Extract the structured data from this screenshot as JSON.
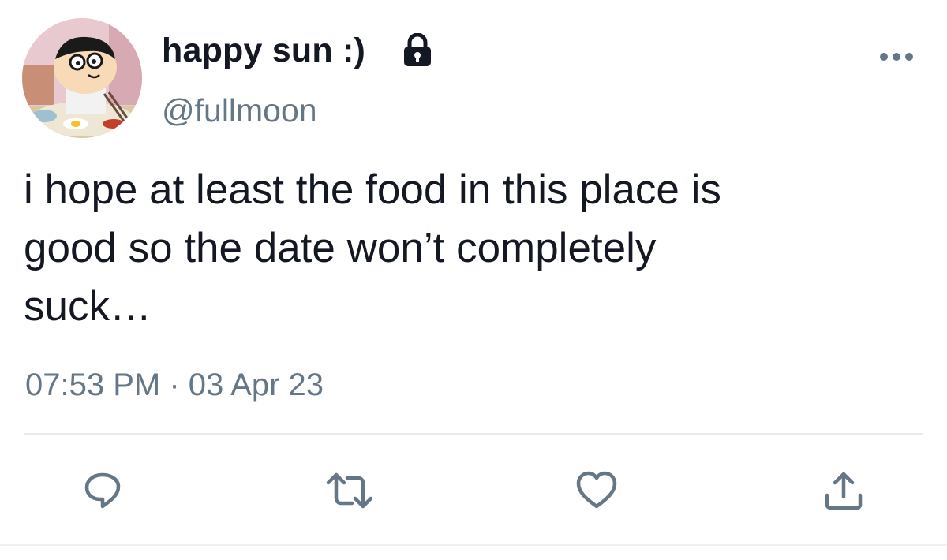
{
  "user": {
    "display_name": "happy sun :)",
    "handle": "@fullmoon",
    "protected_icon": "lock-icon",
    "avatar": "cartoon-avatar"
  },
  "tweet": {
    "text": "i hope at least the food in this place is\ngood so the date won’t completely\nsuck…",
    "timestamp": "07:53 PM · 03 Apr 23"
  },
  "actions": {
    "menu_icon": "more-icon",
    "reply_icon": "reply-icon",
    "retweet_icon": "retweet-icon",
    "like_icon": "heart-icon",
    "share_icon": "share-icon"
  },
  "colors": {
    "text_primary": "#141823",
    "text_secondary": "#657786",
    "icon": "#657786",
    "divider": "#e6ecf0"
  }
}
